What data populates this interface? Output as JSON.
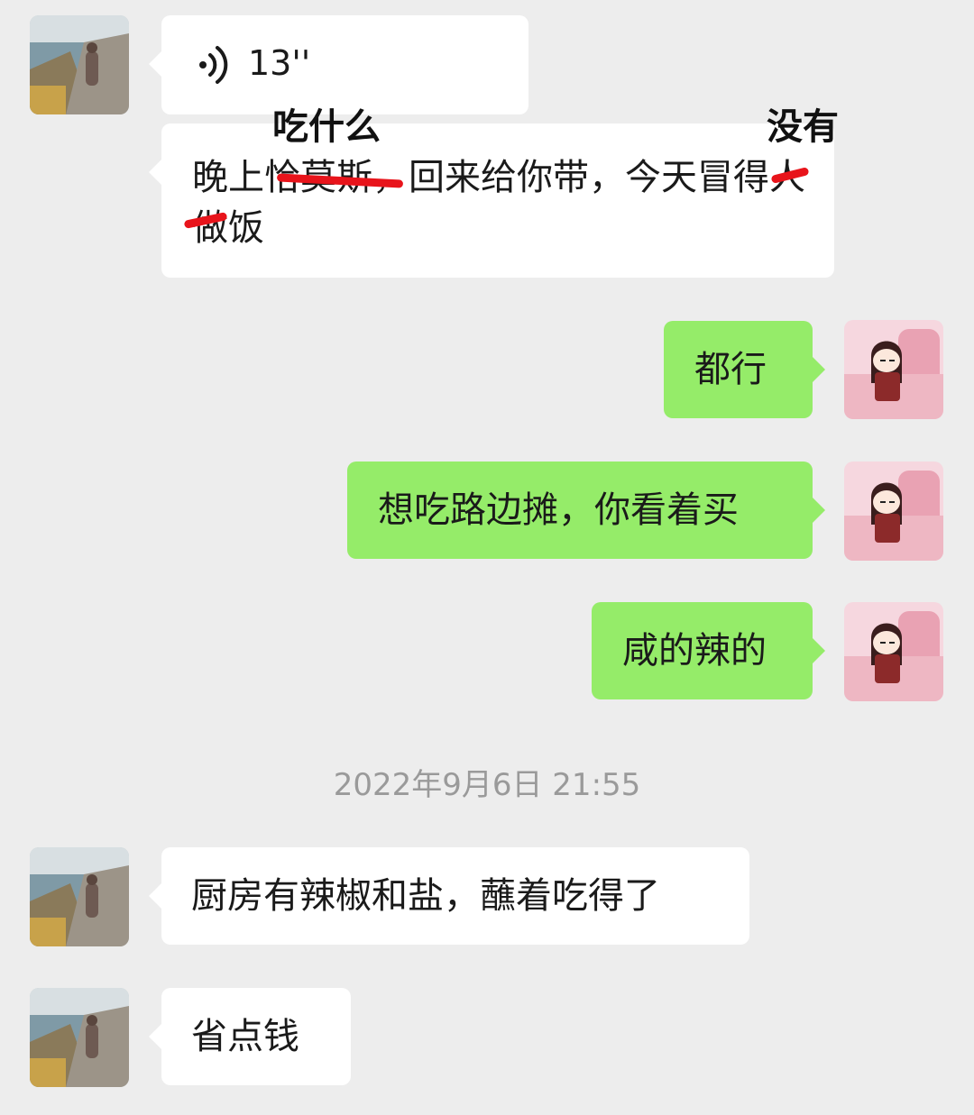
{
  "messages": {
    "voice": {
      "duration": "13''",
      "icon": "voice-wave-icon"
    },
    "m2": {
      "before": "晚上",
      "struck": "恰莫斯",
      "middle": "，回来给你带，今天",
      "struck_char_end": "冒",
      "struck_char_start": "得",
      "after": "人做饭",
      "annotation_1": "吃什么",
      "annotation_2": "没有",
      "strike_color": "#e8141b"
    },
    "m3": {
      "text": "都行"
    },
    "m4": {
      "text": "想吃路边摊，你看着买"
    },
    "m5": {
      "text": "咸的辣的"
    },
    "timestamp": "2022年9月6日 21:55",
    "m6": {
      "text": "厨房有辣椒和盐，蘸着吃得了"
    },
    "m7": {
      "text": "省点钱"
    }
  },
  "colors": {
    "background": "#ededed",
    "incoming_bubble": "#ffffff",
    "outgoing_bubble": "#95ec69",
    "timestamp": "#9a9a9a"
  },
  "avatars": {
    "incoming": "landscape-photo-avatar",
    "outgoing": "cartoon-girl-avatar"
  }
}
